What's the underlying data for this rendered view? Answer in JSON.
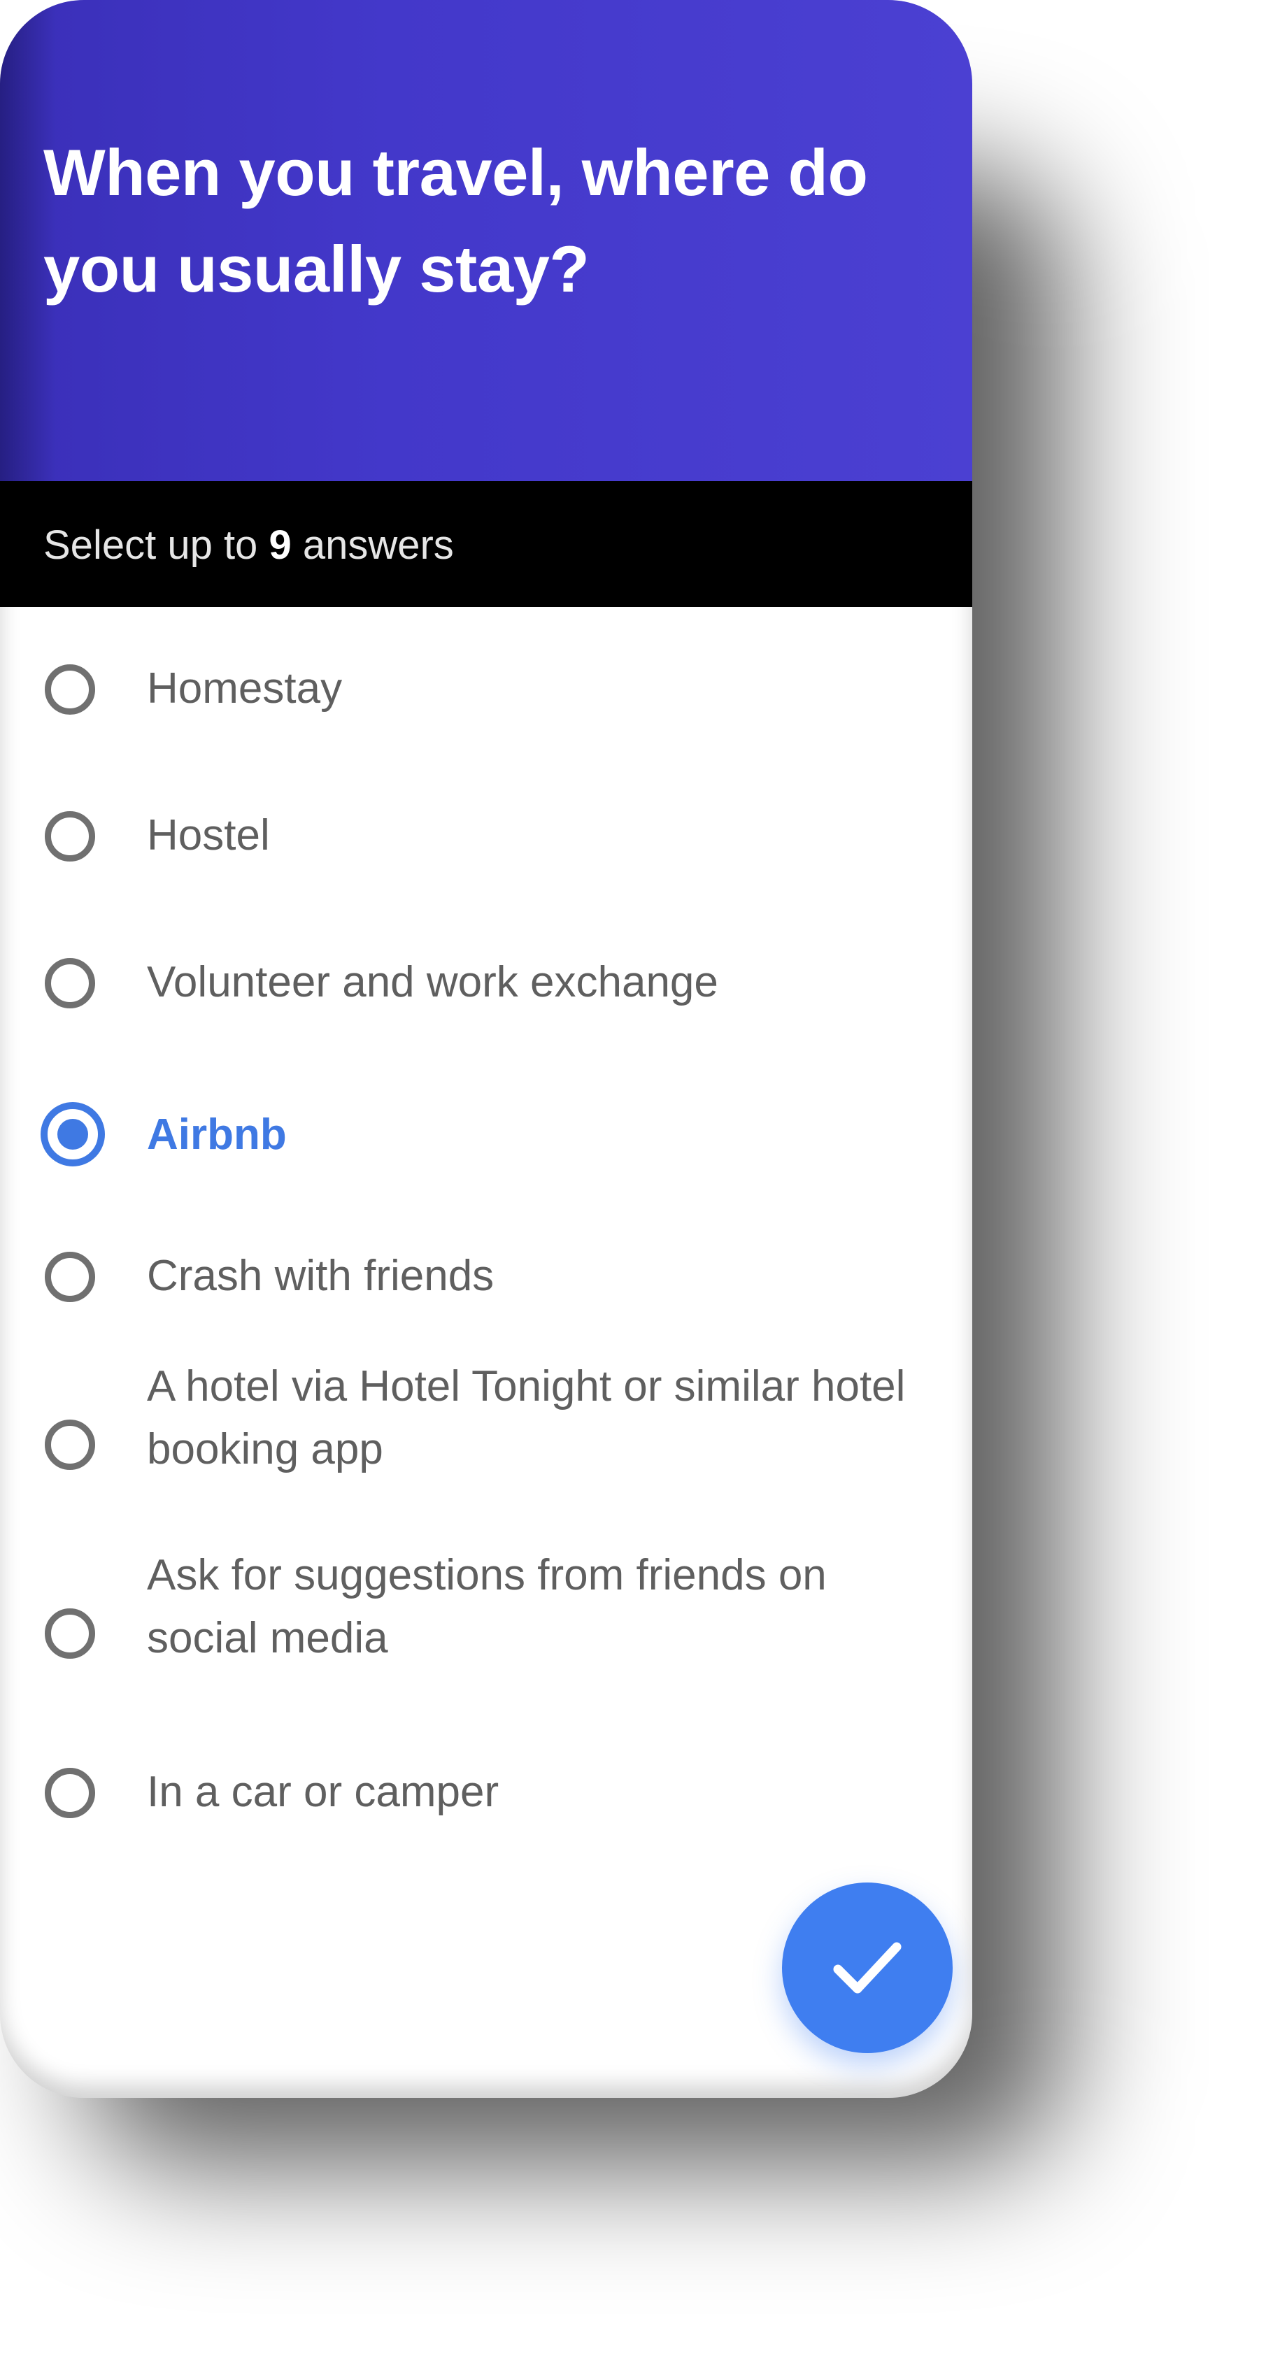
{
  "header": {
    "question": "When you travel, where do you usually stay?",
    "background_color": "#4338ca"
  },
  "subheader": {
    "prefix": "Select up to",
    "count": "9",
    "suffix": "answers"
  },
  "options": [
    {
      "label": "Homestay",
      "selected": false
    },
    {
      "label": "Hostel",
      "selected": false
    },
    {
      "label": "Volunteer and work exchange",
      "selected": false
    },
    {
      "label": "Airbnb",
      "selected": true
    },
    {
      "label": "Crash with friends",
      "selected": false
    },
    {
      "label": "A hotel via Hotel Tonight or similar hotel booking app",
      "selected": false
    },
    {
      "label": "Ask for suggestions from friends on social media",
      "selected": false
    },
    {
      "label": "In a car or camper",
      "selected": false
    }
  ],
  "submit_button": {
    "icon": "check-icon",
    "color": "#3f7ef0"
  },
  "accent_color": "#3f79e3"
}
